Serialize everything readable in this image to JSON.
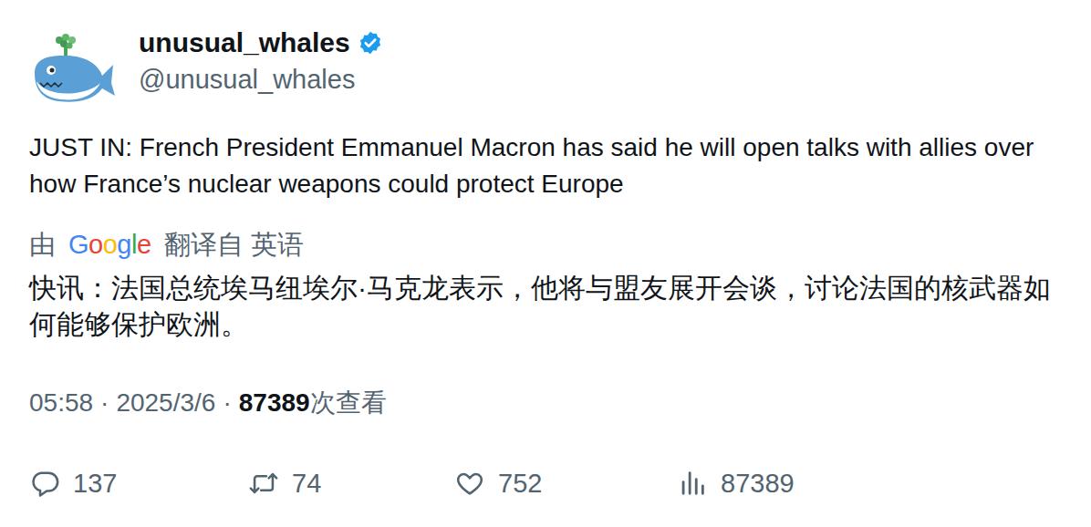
{
  "author": {
    "name": "unusual_whales",
    "handle": "@unusual_whales",
    "verified": true
  },
  "tweet": {
    "text": "JUST IN: French President Emmanuel Macron has said he will open talks with allies over how France’s nuclear weapons could protect Europe"
  },
  "translation": {
    "prefix": "由",
    "provider": "Google",
    "suffix": "翻译自 英语",
    "text": "快讯：法国总统埃马纽埃尔·马克龙表示，他将与盟友展开会谈，讨论法国的核武器如何能够保护欧洲。"
  },
  "meta": {
    "time": "05:58",
    "separator": "·",
    "date": "2025/3/6",
    "views": "87389",
    "views_label": "次查看"
  },
  "actions": [
    {
      "kind": "reply",
      "count": "137"
    },
    {
      "kind": "retweet",
      "count": "74"
    },
    {
      "kind": "like",
      "count": "752"
    },
    {
      "kind": "views",
      "count": "87389"
    }
  ]
}
